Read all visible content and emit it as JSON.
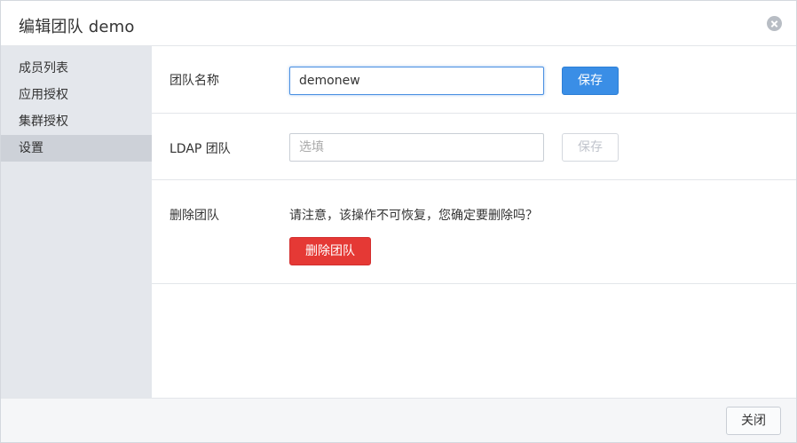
{
  "dialog": {
    "title": "编辑团队 demo",
    "close_icon": "close-icon"
  },
  "sidebar": {
    "items": [
      {
        "label": "成员列表",
        "active": false
      },
      {
        "label": "应用授权",
        "active": false
      },
      {
        "label": "集群授权",
        "active": false
      },
      {
        "label": "设置",
        "active": true
      }
    ]
  },
  "settings": {
    "team_name": {
      "label": "团队名称",
      "value": "demonew",
      "save_label": "保存"
    },
    "ldap": {
      "label": "LDAP 团队",
      "placeholder": "选填",
      "value": "",
      "save_label": "保存"
    },
    "delete": {
      "label": "删除团队",
      "warning": "请注意，该操作不可恢复，您确定要删除吗？",
      "button_label": "删除团队"
    }
  },
  "footer": {
    "close_label": "关闭"
  },
  "colors": {
    "primary": "#3a8ee6",
    "danger": "#e53935",
    "sidebar_bg": "#e4e7ec",
    "sidebar_active": "#cdd1d8"
  }
}
